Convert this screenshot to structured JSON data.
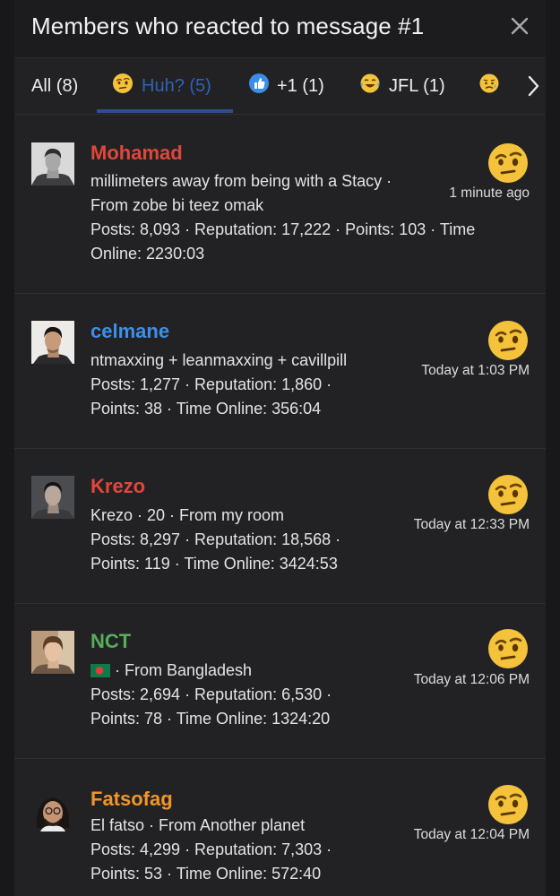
{
  "modal": {
    "title": "Members who reacted to message #1"
  },
  "tabs": [
    {
      "label": "All (8)"
    },
    {
      "label": "Huh? (5)"
    },
    {
      "label": "+1 (1)"
    },
    {
      "label": "JFL (1)"
    }
  ],
  "members": [
    {
      "name": "Mohamad",
      "name_color": "#e0473a",
      "line1": "millimeters away from being with a Stacy ·",
      "line2": "From zobe bi teez omak",
      "line3": "Posts: 8,093 · Reputation: 17,222 · Points: 103 · Time",
      "line4": "Online: 2230:03",
      "time": "1 minute ago"
    },
    {
      "name": "celmane",
      "name_color": "#3d8fe8",
      "line1": "ntmaxxing + leanmaxxing + cavillpill",
      "line2": "Posts: 1,277 · Reputation: 1,860 ·",
      "line3": "Points: 38 · Time Online: 356:04",
      "time": "Today at 1:03 PM"
    },
    {
      "name": "Krezo",
      "name_color": "#e0473a",
      "line1": "Krezo · 20 · From my room",
      "line2": "Posts: 8,297 · Reputation: 18,568 ·",
      "line3": "Points: 119 · Time Online: 3424:53",
      "time": "Today at 12:33 PM"
    },
    {
      "name": "NCT",
      "name_color": "#58ad5a",
      "line1": " · From Bangladesh",
      "line2": "Posts: 2,694 · Reputation: 6,530 ·",
      "line3": "Points: 78 · Time Online: 1324:20",
      "time": "Today at 12:06 PM"
    },
    {
      "name": "Fatsofag",
      "name_color": "#f0962a",
      "line1": "El fatso · From Another planet",
      "line2": "Posts: 4,299 · Reputation: 7,303 ·",
      "line3": "Points: 53 · Time Online: 572:40",
      "time": "Today at 12:04 PM"
    }
  ],
  "icons": {
    "close": "close-icon",
    "tab_next": "chevron-right-icon",
    "reaction": "face-with-raised-eyebrow-emoji",
    "flag": "bangladesh-flag"
  },
  "colors": {
    "active_tab": "#2f63b5",
    "tab_underline": "#2c4f8d",
    "modal_bg": "#222224",
    "header_bg": "#1c1c1e"
  }
}
